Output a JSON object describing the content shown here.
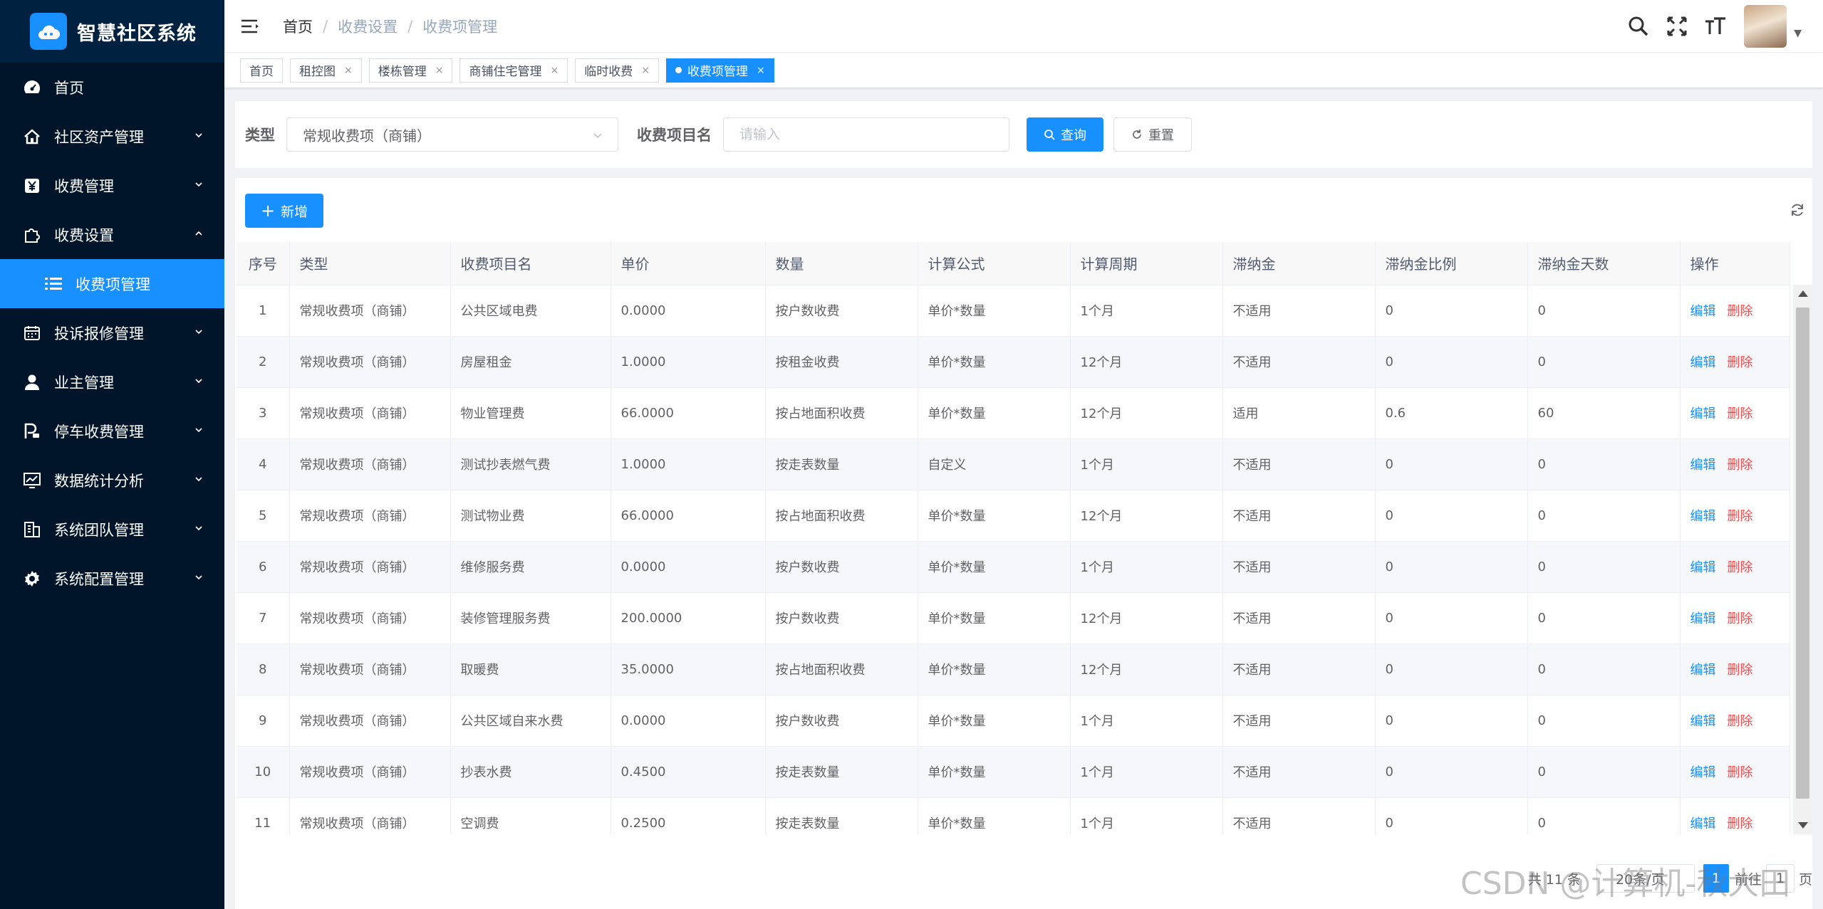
{
  "app": {
    "title": "智慧社区系统"
  },
  "sidebar": {
    "items": [
      {
        "label": "首页",
        "icon": "dashboard-icon"
      },
      {
        "label": "社区资产管理",
        "icon": "house-icon"
      },
      {
        "label": "收费管理",
        "icon": "yen-icon"
      },
      {
        "label": "收费设置",
        "icon": "puzzle-icon"
      },
      {
        "label": "收费项管理",
        "icon": "list-icon",
        "active": true
      },
      {
        "label": "投诉报修管理",
        "icon": "calendar-icon"
      },
      {
        "label": "业主管理",
        "icon": "user-icon"
      },
      {
        "label": "停车收费管理",
        "icon": "parking-icon"
      },
      {
        "label": "数据统计分析",
        "icon": "monitor-chart-icon"
      },
      {
        "label": "系统团队管理",
        "icon": "building-icon"
      },
      {
        "label": "系统配置管理",
        "icon": "gear-icon"
      }
    ]
  },
  "breadcrumb": {
    "home": "首页",
    "level1": "收费设置",
    "level2": "收费项管理"
  },
  "tags": [
    {
      "label": "首页"
    },
    {
      "label": "租控图"
    },
    {
      "label": "楼栋管理"
    },
    {
      "label": "商铺住宅管理"
    },
    {
      "label": "临时收费"
    },
    {
      "label": "收费项管理"
    }
  ],
  "search": {
    "type_label": "类型",
    "type_value": "常规收费项（商铺）",
    "name_label": "收费项目名",
    "name_placeholder": "请输入",
    "query_label": "查询",
    "reset_label": "重置"
  },
  "toolbar": {
    "add_label": "新增"
  },
  "table": {
    "headers": [
      "序号",
      "类型",
      "收费项目名",
      "单价",
      "数量",
      "计算公式",
      "计算周期",
      "滞纳金",
      "滞纳金比例",
      "滞纳金天数",
      "操作"
    ],
    "edit_label": "编辑",
    "delete_label": "删除",
    "rows": [
      [
        "1",
        "常规收费项（商铺）",
        "公共区域电费",
        "0.0000",
        "按户数收费",
        "单价*数量",
        "1个月",
        "不适用",
        "0",
        "0"
      ],
      [
        "2",
        "常规收费项（商铺）",
        "房屋租金",
        "1.0000",
        "按租金收费",
        "单价*数量",
        "12个月",
        "不适用",
        "0",
        "0"
      ],
      [
        "3",
        "常规收费项（商铺）",
        "物业管理费",
        "66.0000",
        "按占地面积收费",
        "单价*数量",
        "12个月",
        "适用",
        "0.6",
        "60"
      ],
      [
        "4",
        "常规收费项（商铺）",
        "测试抄表燃气费",
        "1.0000",
        "按走表数量",
        "自定义",
        "1个月",
        "不适用",
        "0",
        "0"
      ],
      [
        "5",
        "常规收费项（商铺）",
        "测试物业费",
        "66.0000",
        "按占地面积收费",
        "单价*数量",
        "12个月",
        "不适用",
        "0",
        "0"
      ],
      [
        "6",
        "常规收费项（商铺）",
        "维修服务费",
        "0.0000",
        "按户数收费",
        "单价*数量",
        "1个月",
        "不适用",
        "0",
        "0"
      ],
      [
        "7",
        "常规收费项（商铺）",
        "装修管理服务费",
        "200.0000",
        "按户数收费",
        "单价*数量",
        "12个月",
        "不适用",
        "0",
        "0"
      ],
      [
        "8",
        "常规收费项（商铺）",
        "取暖费",
        "35.0000",
        "按占地面积收费",
        "单价*数量",
        "12个月",
        "不适用",
        "0",
        "0"
      ],
      [
        "9",
        "常规收费项（商铺）",
        "公共区域自来水费",
        "0.0000",
        "按户数收费",
        "单价*数量",
        "1个月",
        "不适用",
        "0",
        "0"
      ],
      [
        "10",
        "常规收费项（商铺）",
        "抄表水费",
        "0.4500",
        "按走表数量",
        "单价*数量",
        "1个月",
        "不适用",
        "0",
        "0"
      ],
      [
        "11",
        "常规收费项（商铺）",
        "空调费",
        "0.2500",
        "按走表数量",
        "单价*数量",
        "1个月",
        "不适用",
        "0",
        "0"
      ]
    ]
  },
  "pagination": {
    "total": "共 11 条",
    "page_size": "20条/页",
    "current_page": "1",
    "jump_prefix": "前往",
    "jump_value": "1",
    "jump_suffix": "页"
  },
  "watermark": "CSDN @计算机-秋大田",
  "colors": {
    "primary": "#1890ff",
    "sidebar_bg": "#001529",
    "danger": "#ff4949"
  }
}
